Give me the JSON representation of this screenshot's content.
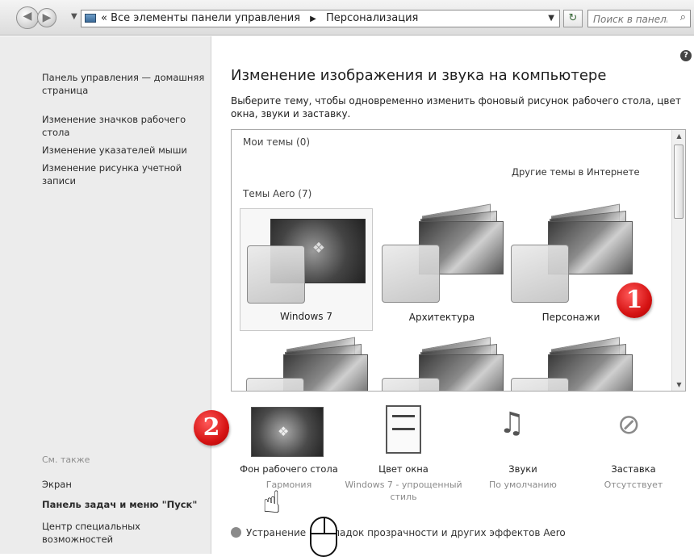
{
  "address_bar": {
    "breadcrumb_prefix": "«",
    "breadcrumb_all": "Все элементы панели управления",
    "breadcrumb_sep": "▶",
    "breadcrumb_current": "Персонализация",
    "search_placeholder": "Поиск в панели ..."
  },
  "left_pane": {
    "home": "Панель управления — домашняя страница",
    "links": [
      "Изменение значков рабочего стола",
      "Изменение указателей мыши",
      "Изменение рисунка учетной записи"
    ],
    "see_also_label": "См. также",
    "see_also": [
      "Экран",
      "Панель задач и меню \"Пуск\"",
      "Центр специальных возможностей"
    ]
  },
  "main": {
    "title": "Изменение изображения и звука на компьютере",
    "description": "Выберите тему, чтобы одновременно изменить фоновый рисунок рабочего стола, цвет окна, звуки и заставку.",
    "my_themes": "Мои темы (0)",
    "online_link": "Другие темы в Интернете",
    "aero_group": "Темы Aero (7)",
    "themes": [
      "Windows 7",
      "Архитектура",
      "Персонажи"
    ],
    "badge_1": "1",
    "badge_2": "2"
  },
  "settings": {
    "desktop_bg": {
      "title": "Фон рабочего стола",
      "sub": "Гармония"
    },
    "window_color": {
      "title": "Цвет окна",
      "sub": "Windows 7 - упрощенный стиль"
    },
    "sounds": {
      "title": "Звуки",
      "sub": "По умолчанию"
    },
    "screensaver": {
      "title": "Заставка",
      "sub": "Отсутствует"
    }
  },
  "aero_troubleshoot": "Устранение неполадок прозрачности и других эффектов Aero"
}
